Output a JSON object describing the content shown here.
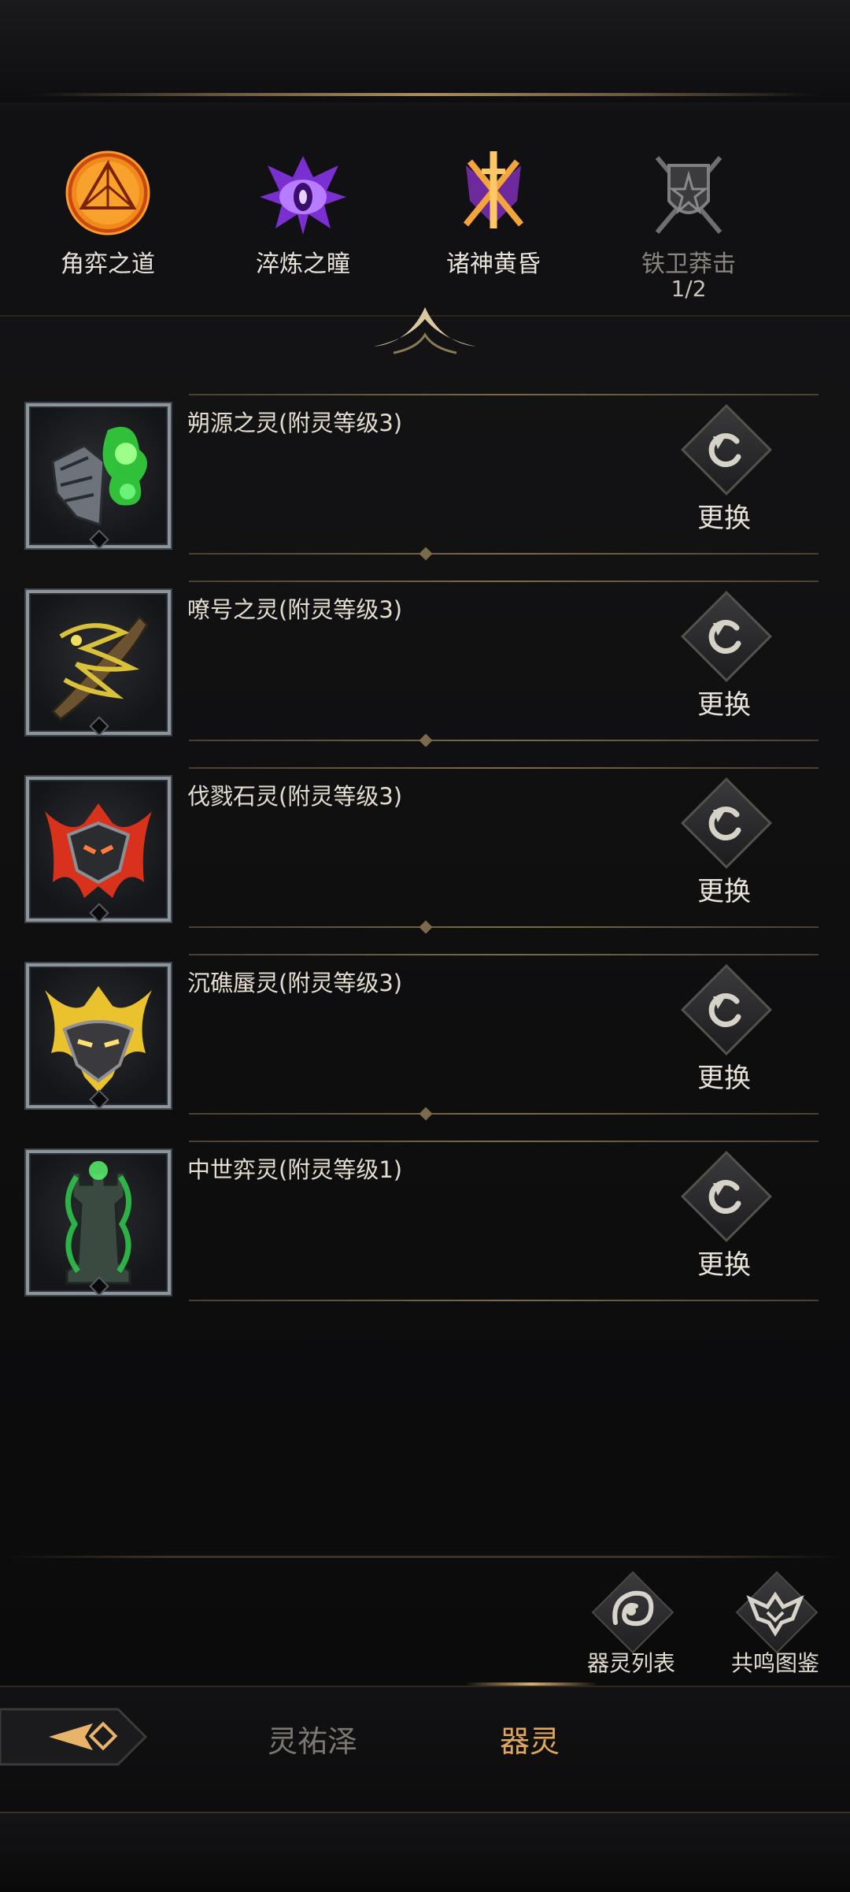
{
  "tabs": [
    {
      "label": "角弈之道",
      "sub": "",
      "state": "active",
      "icon": "orange-d20-emblem-icon",
      "color": "#f07a1a"
    },
    {
      "label": "淬炼之瞳",
      "sub": "",
      "state": "active",
      "icon": "purple-eye-emblem-icon",
      "color": "#9b4bf0"
    },
    {
      "label": "诸神黄昏",
      "sub": "",
      "state": "active",
      "icon": "crossed-swords-emblem-icon",
      "color": "#f0a03a"
    },
    {
      "label": "铁卫莽击",
      "sub": "1/2",
      "state": "locked",
      "icon": "grey-shield-axes-emblem-icon",
      "color": "#8a8a8a"
    }
  ],
  "spirits": [
    {
      "name": "朔源之灵(附灵等级3)",
      "action": "更换",
      "icon": "green-spirit-gauntlet-icon",
      "accent": "#3fd14a"
    },
    {
      "name": "嘹号之灵(附灵等级3)",
      "action": "更换",
      "icon": "yellow-spirit-horn-icon",
      "accent": "#d9c23a"
    },
    {
      "name": "伐戮石灵(附灵等级3)",
      "action": "更换",
      "icon": "red-flame-mask-icon",
      "accent": "#e8452a"
    },
    {
      "name": "沉礁蜃灵(附灵等级3)",
      "action": "更换",
      "icon": "gold-flame-mask-icon",
      "accent": "#e9c22e"
    },
    {
      "name": "中世弈灵(附灵等级1)",
      "action": "更换",
      "icon": "green-chess-rook-icon",
      "accent": "#2fc24a"
    }
  ],
  "actions": {
    "list_label": "器灵列表",
    "codex_label": "共鸣图鉴"
  },
  "nav": {
    "tab1": "灵祐泽",
    "tab2": "器灵"
  }
}
